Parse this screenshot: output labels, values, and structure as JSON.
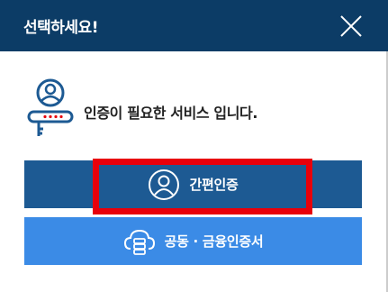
{
  "dialog": {
    "title": "선택하세요!",
    "message": "인증이 필요한 서비스 입니다.",
    "buttons": {
      "simple_auth": "간편인증",
      "joint_financial_auth": "공동 · 금융인증서"
    }
  },
  "colors": {
    "header_bg": "#0c3c66",
    "simple_button_bg": "#1d5a93",
    "joint_button_bg": "#3b8be6",
    "highlight_border": "#e8000b"
  },
  "icons": {
    "close": "close-icon",
    "intro": "user-key-icon",
    "simple": "user-circle-icon",
    "joint": "cloud-server-icon"
  }
}
